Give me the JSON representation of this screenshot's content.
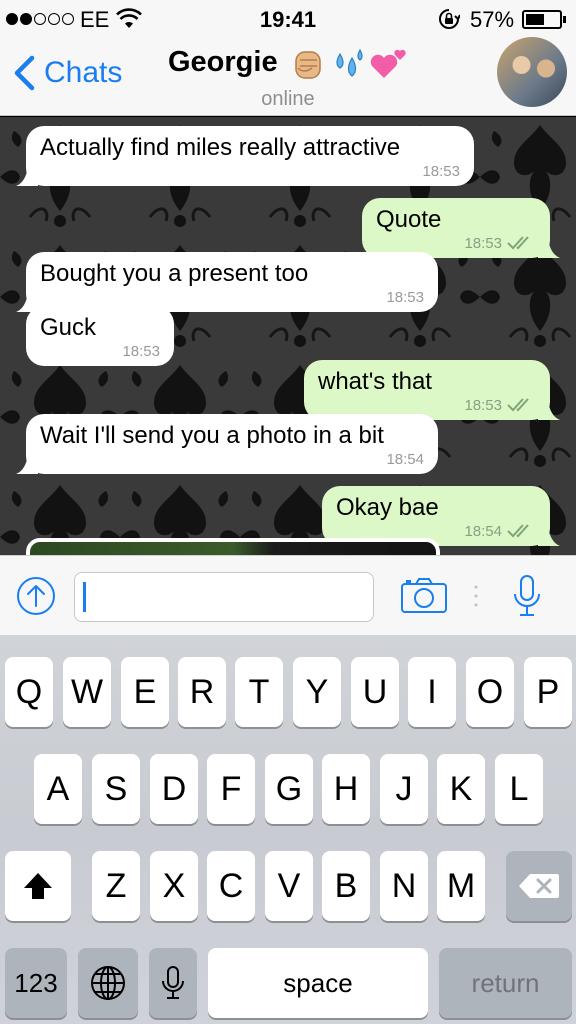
{
  "status_bar": {
    "carrier": "EE",
    "time": "19:41",
    "battery_percent": "57%",
    "battery_level": 0.57,
    "signal_bars_filled": 2,
    "signal_bars_total": 5
  },
  "nav": {
    "back_label": "Chats",
    "contact_name": "Georgie",
    "contact_emojis": [
      "raised-fist-emoji",
      "sweat-droplets-emoji",
      "growing-heart-emoji"
    ],
    "presence": "online"
  },
  "messages": [
    {
      "direction": "in",
      "text": "Actually find miles really attractive",
      "time": "18:53"
    },
    {
      "direction": "out",
      "text": "Quote",
      "time": "18:53",
      "status": "read-ticks"
    },
    {
      "direction": "in",
      "text": "Bought you a present too",
      "time": "18:53"
    },
    {
      "direction": "in",
      "text": "Guck",
      "time": "18:53"
    },
    {
      "direction": "out",
      "text": "what's that",
      "time": "18:53",
      "status": "read-ticks"
    },
    {
      "direction": "in",
      "text": "Wait I'll send you a photo in a bit",
      "time": "18:54"
    },
    {
      "direction": "out",
      "text": "Okay bae",
      "time": "18:54",
      "status": "read-ticks"
    }
  ],
  "input": {
    "value": "",
    "placeholder": ""
  },
  "keyboard": {
    "row1": [
      "Q",
      "W",
      "E",
      "R",
      "T",
      "Y",
      "U",
      "I",
      "O",
      "P"
    ],
    "row2": [
      "A",
      "S",
      "D",
      "F",
      "G",
      "H",
      "J",
      "K",
      "L"
    ],
    "row3": [
      "Z",
      "X",
      "C",
      "V",
      "B",
      "N",
      "M"
    ],
    "numbers_label": "123",
    "space_label": "space",
    "return_label": "return"
  },
  "colors": {
    "accent": "#1a7ef0",
    "incoming_bubble": "#ffffff",
    "outgoing_bubble": "#dcf8c6",
    "tick": "#7fa37a"
  }
}
